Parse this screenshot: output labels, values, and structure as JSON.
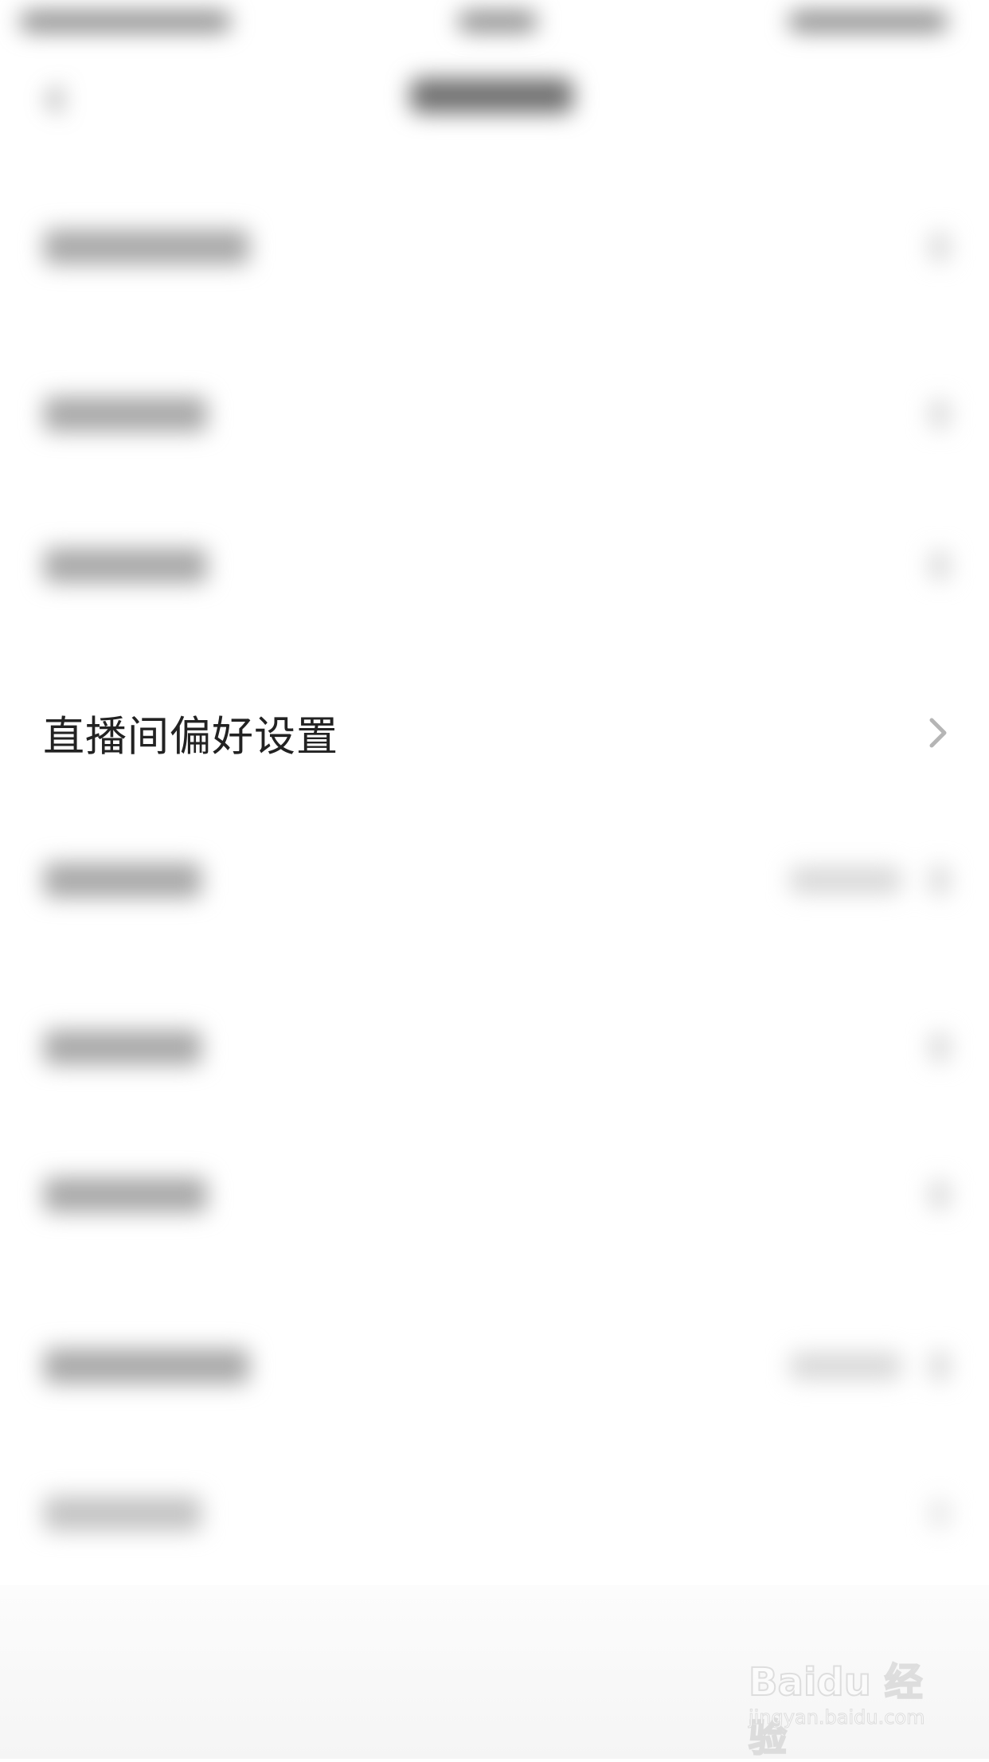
{
  "settings": {
    "live_room_preference_label": "直播间偏好设置"
  },
  "watermark": {
    "logo": "Baidu 经验",
    "url": "jingyan.baidu.com"
  },
  "colors": {
    "background": "#ffffff",
    "label": "#222222",
    "chevron": "#b5b5b5"
  }
}
